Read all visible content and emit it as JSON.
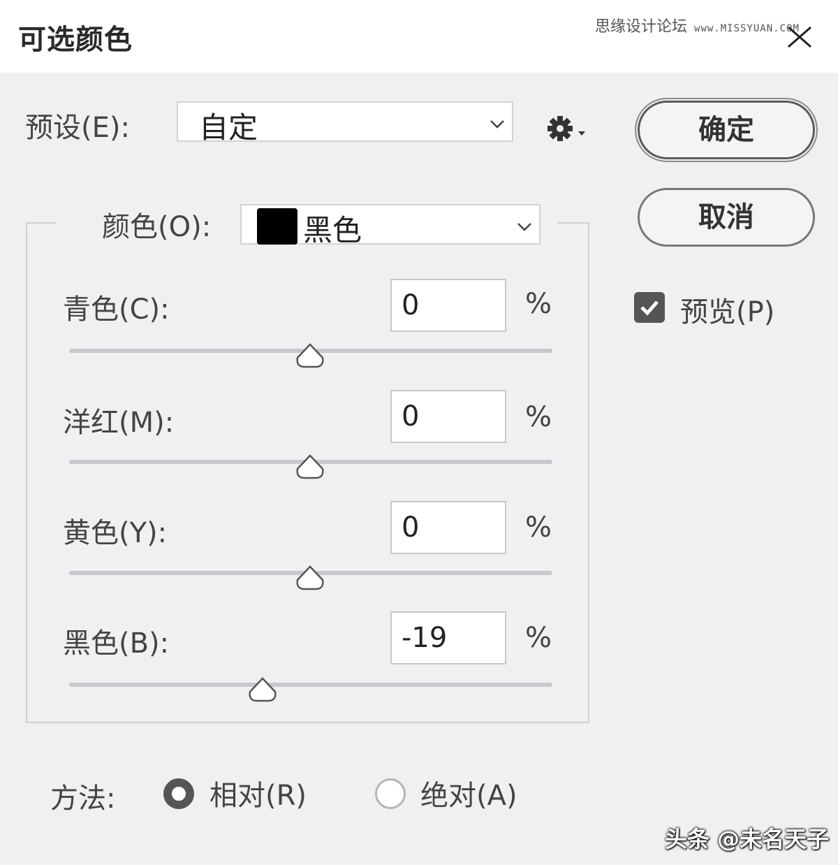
{
  "dialog": {
    "title": "可选颜色",
    "close_icon": "close-icon"
  },
  "watermark": {
    "site_name": "思缘设计论坛",
    "site_url": "www.MISSYUAN.COM",
    "author": "头条 @未名天子"
  },
  "preset": {
    "label": "预设(E):",
    "value": "自定",
    "gear_icon": "gear-icon"
  },
  "buttons": {
    "ok": "确定",
    "cancel": "取消"
  },
  "preview": {
    "label": "预览(P)",
    "checked": true
  },
  "colors": {
    "label": "颜色(O):",
    "value": "黑色",
    "swatch_color": "#000000"
  },
  "sliders": [
    {
      "label": "青色(C):",
      "value": "0",
      "unit": "%"
    },
    {
      "label": "洋红(M):",
      "value": "0",
      "unit": "%"
    },
    {
      "label": "黄色(Y):",
      "value": "0",
      "unit": "%"
    },
    {
      "label": "黑色(B):",
      "value": "-19",
      "unit": "%"
    }
  ],
  "method": {
    "label": "方法:",
    "options": [
      {
        "label": "相对(R)",
        "selected": true
      },
      {
        "label": "绝对(A)",
        "selected": false
      }
    ]
  },
  "theme": {
    "background": "#f0eff2",
    "titlebar": "#ffffff",
    "accent_dark": "#555555"
  }
}
